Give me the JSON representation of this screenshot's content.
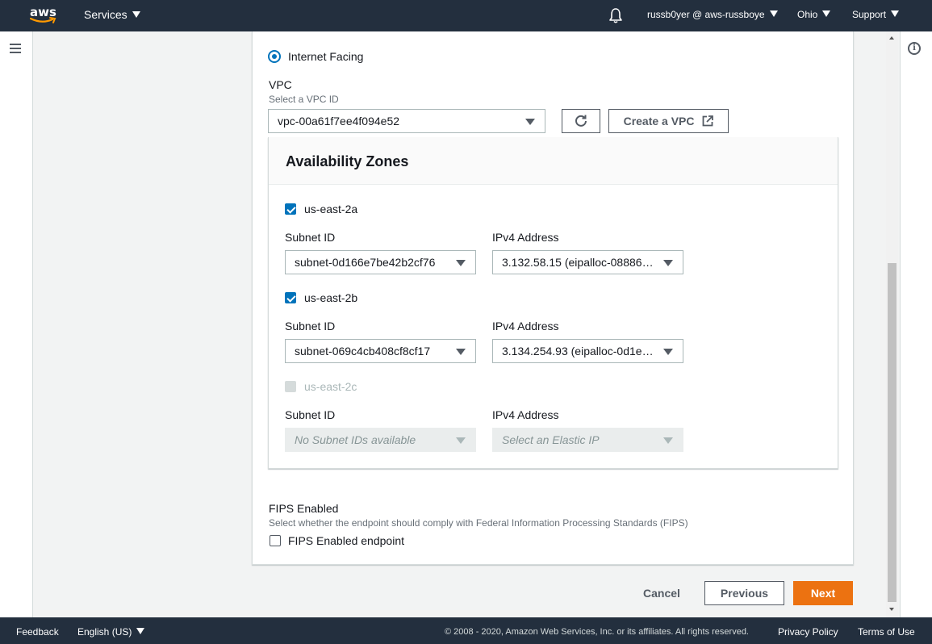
{
  "topnav": {
    "logo_text": "aws",
    "services_label": "Services",
    "user_label": "russb0yer @ aws-russboye",
    "region_label": "Ohio",
    "support_label": "Support"
  },
  "form": {
    "scheme_option_label": "Internet Facing",
    "vpc": {
      "label": "VPC",
      "description": "Select a VPC ID",
      "value": "vpc-00a61f7ee4f094e52",
      "create_label": "Create a VPC"
    },
    "availability_zones": {
      "title": "Availability Zones",
      "subnet_label": "Subnet ID",
      "ipv4_label": "IPv4 Address",
      "zones": [
        {
          "name": "us-east-2a",
          "checked": true,
          "subnet": "subnet-0d166e7be42b2cf76",
          "ipv4": "3.132.58.15 (eipalloc-08886…"
        },
        {
          "name": "us-east-2b",
          "checked": true,
          "subnet": "subnet-069c4cb408cf8cf17",
          "ipv4": "3.134.254.93 (eipalloc-0d1e…"
        },
        {
          "name": "us-east-2c",
          "checked": false,
          "subnet": "No Subnet IDs available",
          "ipv4": "Select an Elastic IP"
        }
      ]
    },
    "fips": {
      "label": "FIPS Enabled",
      "description": "Select whether the endpoint should comply with Federal Information Processing Standards (FIPS)",
      "checkbox_label": "FIPS Enabled endpoint"
    }
  },
  "actions": {
    "cancel": "Cancel",
    "previous": "Previous",
    "next": "Next"
  },
  "footer": {
    "feedback": "Feedback",
    "language": "English (US)",
    "copyright": "© 2008 - 2020, Amazon Web Services, Inc. or its affiliates. All rights reserved.",
    "privacy": "Privacy Policy",
    "terms": "Terms of Use"
  },
  "colors": {
    "nav_bg": "#232f3e",
    "primary": "#ec7211",
    "accent": "#0073bb"
  }
}
